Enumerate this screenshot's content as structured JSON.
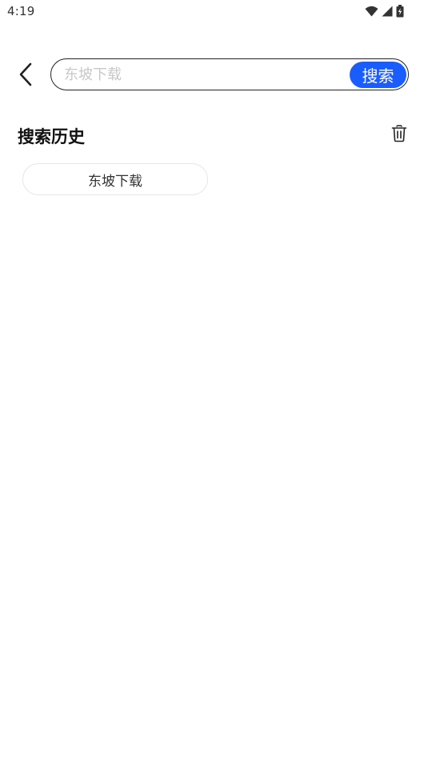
{
  "status_bar": {
    "time": "4:19",
    "icons": [
      "wifi-icon",
      "cell-signal-icon",
      "battery-charging-icon"
    ]
  },
  "header": {
    "back_icon": "chevron-left-icon",
    "search": {
      "value": "",
      "placeholder": "东坡下载",
      "button_label": "搜索"
    }
  },
  "history": {
    "title": "搜索历史",
    "clear_icon": "trash-icon",
    "items": [
      {
        "label": "东坡下载"
      }
    ]
  },
  "colors": {
    "accent": "#1a5dff",
    "text": "#111111",
    "placeholder": "#c8c8c8",
    "chip_border": "#e6e6e6"
  }
}
